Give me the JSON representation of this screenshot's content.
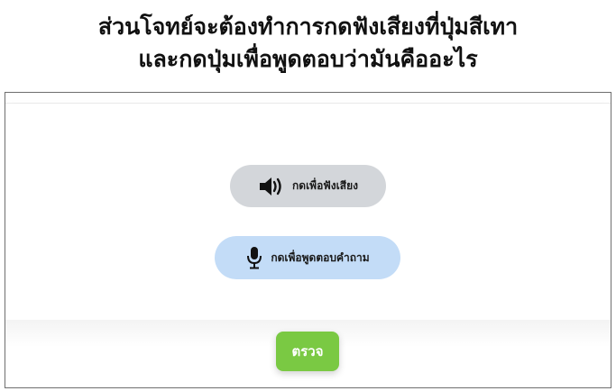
{
  "instruction": {
    "line1": "ส่วนโจทย์จะต้องทำการกดฟังเสียงที่ปุ่มสีเทา",
    "line2": "และกดปุ่มเพื่อพูดตอบว่ามันคืออะไร"
  },
  "buttons": {
    "listen": {
      "label": "กดเพื่อฟังเสียง",
      "icon": "speaker-icon",
      "color": "#d3d6da"
    },
    "speak": {
      "label": "กดเพื่อพูดตอบคำถาม",
      "icon": "microphone-icon",
      "color": "#c3dcf7"
    },
    "check": {
      "label": "ตรวจ",
      "color": "#7ac943"
    }
  }
}
